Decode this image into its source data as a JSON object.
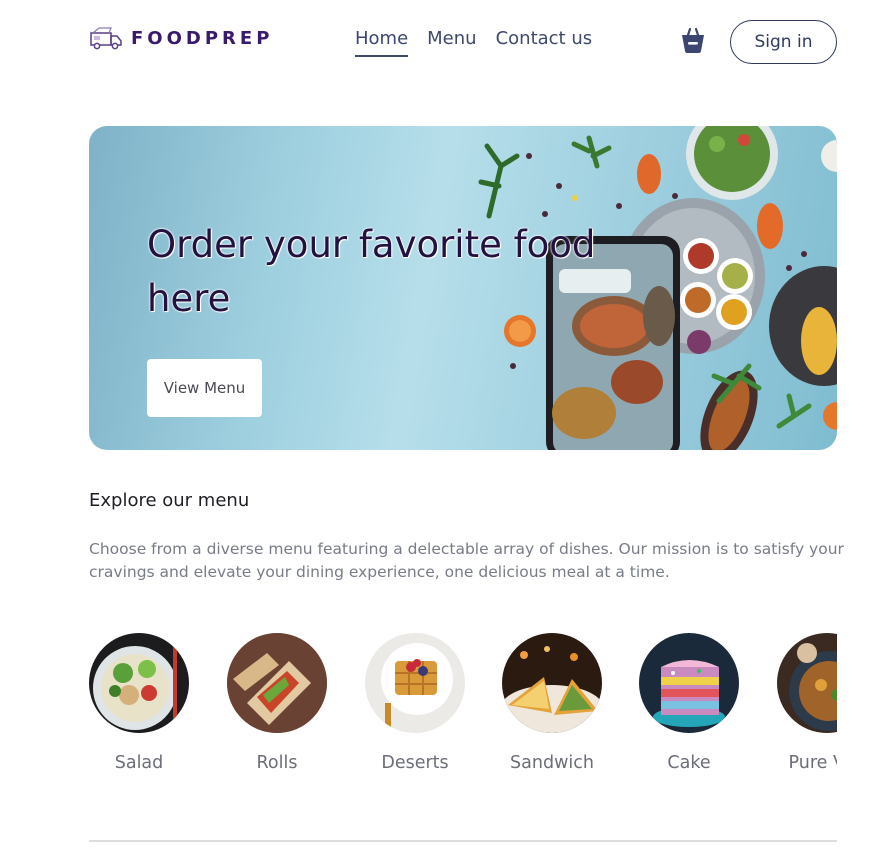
{
  "brand": {
    "name": "FOODPREP",
    "logo_icon": "food-truck-icon",
    "accent": "#3a1b6b"
  },
  "nav": {
    "links": [
      {
        "label": "Home",
        "active": true
      },
      {
        "label": "Menu",
        "active": false
      },
      {
        "label": "Contact us",
        "active": false
      }
    ],
    "basket_icon": "basket-icon",
    "signin_label": "Sign in"
  },
  "hero": {
    "title": "Order your favorite food here",
    "button_label": "View Menu"
  },
  "explore": {
    "title": "Explore our menu",
    "description": "Choose from a diverse menu featuring a delectable array of dishes. Our mission is to satisfy your cravings and elevate your dining experience, one delicious meal at a time."
  },
  "categories": [
    {
      "label": "Salad"
    },
    {
      "label": "Rolls"
    },
    {
      "label": "Deserts"
    },
    {
      "label": "Sandwich"
    },
    {
      "label": "Cake"
    },
    {
      "label": "Pure Veg"
    }
  ]
}
